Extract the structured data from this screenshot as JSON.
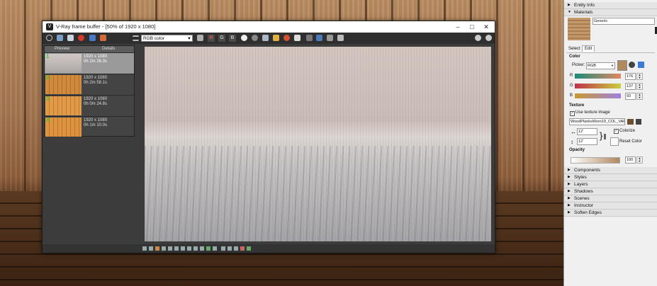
{
  "vfb": {
    "title": "V-Ray frame buffer - [50% of 1920 x 1080]",
    "channel_select": "RGB color",
    "letters": [
      "R",
      "G",
      "B"
    ],
    "history_headers": [
      "Preview",
      "Details"
    ],
    "history": [
      {
        "num": "1",
        "res": "1920 x 1080",
        "time": "0h 2m 26.3s",
        "selected": true
      },
      {
        "num": "2",
        "res": "1920 x 1080",
        "time": "0h 2m 58.1s",
        "selected": false
      },
      {
        "num": "3",
        "res": "1920 x 1080",
        "time": "0h 0m 24.8s",
        "selected": false
      },
      {
        "num": "4",
        "res": "1920 x 1080",
        "time": "0h 1m 10.0s",
        "selected": false
      }
    ]
  },
  "tray": {
    "entity_info": "Entity Info",
    "materials": "Materials",
    "material_name": "Generic",
    "tabs": [
      "Select",
      "Edit"
    ],
    "color_label": "Color",
    "picker_label": "Picker:",
    "picker_value": "RGB",
    "r_label": "R",
    "g_label": "G",
    "b_label": "B",
    "r_value": "176",
    "g_value": "137",
    "b_value": "93",
    "texture_label": "Texture",
    "use_texture": "Use texture image",
    "texture_file": "WoodPlanksWorn19_COL_VAR",
    "width_value": "12'",
    "height_value": "12'",
    "colorize": "Colorize",
    "reset_color": "Reset Color",
    "opacity_label": "Opacity",
    "opacity_value": "100",
    "sections": [
      "Components",
      "Styles",
      "Layers",
      "Shadows",
      "Scenes",
      "Instructor",
      "Soften Edges"
    ],
    "swatch_color": "#b0895d"
  }
}
